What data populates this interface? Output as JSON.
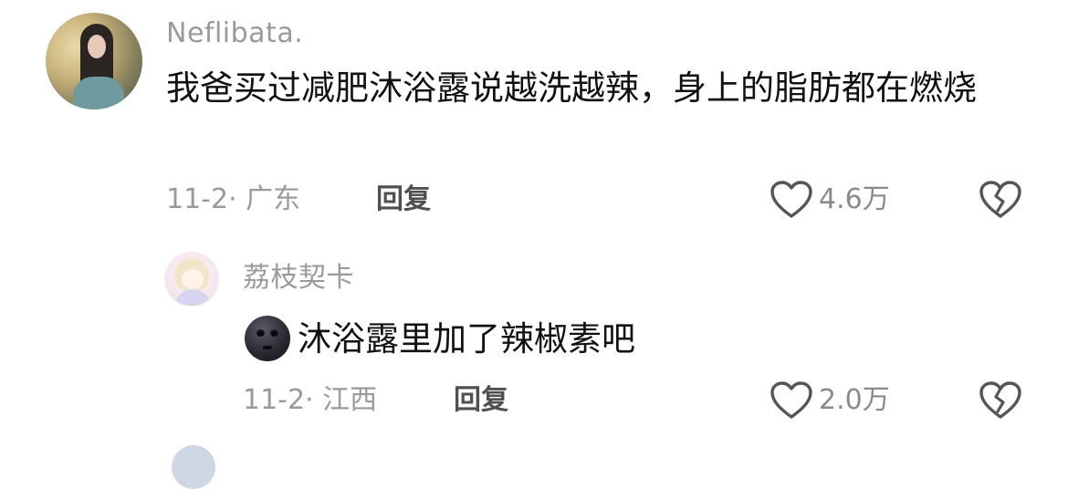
{
  "comments": [
    {
      "username": "Neflibata.",
      "text": "我爸买过减肥沐浴露说越洗越辣，身上的脂肪都在燃烧",
      "date": "11-2",
      "location": "广东",
      "reply_label": "回复",
      "likes": "4.6万",
      "reply": {
        "username": "荔枝契卡",
        "emoji": "new-moon-face",
        "text": "沐浴露里加了辣椒素吧",
        "date": "11-2",
        "location": "江西",
        "reply_label": "回复",
        "likes": "2.0万"
      }
    }
  ],
  "colors": {
    "username": "#9a9a9a",
    "text": "#111111",
    "meta": "#9a9a9a",
    "reply_button": "#4f4f4f",
    "icon": "#555555"
  }
}
